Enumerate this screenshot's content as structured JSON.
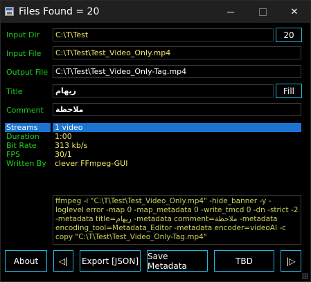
{
  "window": {
    "title": "Files Found = 20",
    "min": "—",
    "max": "□",
    "close": "✕"
  },
  "fields": {
    "input_dir": {
      "label": "Input Dir",
      "value": "C:\\T\\Test"
    },
    "input_file": {
      "label": "Input File",
      "value": "C:\\T\\Test\\Test_Video_Only.mp4"
    },
    "output_file": {
      "label": "Output File",
      "value": "C:\\T\\Test\\Test_Video_Only-Tag.mp4"
    },
    "title": {
      "label": "Title",
      "value": "ريهام"
    },
    "comment": {
      "label": "Comment",
      "value": "ملاحظة"
    }
  },
  "side_buttons": {
    "count": "20",
    "fill": "Fill"
  },
  "info": {
    "streams": {
      "label": "Streams",
      "value": "1 video"
    },
    "duration": {
      "label": "Duration",
      "value": "1:00"
    },
    "bitrate": {
      "label": "Bit Rate",
      "value": "313 kb/s"
    },
    "fps": {
      "label": "FPS",
      "value": "30/1"
    },
    "writtenby": {
      "label": "Written By",
      "value": "clever FFmpeg-GUI"
    }
  },
  "command": "ffmpeg -i \"C:\\T\\Test\\Test_Video_Only.mp4\" -hide_banner -y -loglevel error -map 0 -map_metadata 0 -write_tmcd 0 -dn -strict -2 -metadata title=ريهام -metadata comment=ملاحظة -metadata encoding_tool=Metadata_Editor -metadata encoder=videoAI -c copy \"C:\\T\\Test\\Test_Video_Only-Tag.mp4\"",
  "buttons": {
    "about": "About",
    "prev": "◁|",
    "export": "Export [JSON]",
    "save": "Save Metadata",
    "tbd": "TBD",
    "next": "|▷"
  },
  "colors": {
    "label_green": "#1fcf1f",
    "value_yellow": "#f5e66a",
    "accent_blue": "#1fb7e0",
    "selection_blue": "#1a74d2"
  }
}
